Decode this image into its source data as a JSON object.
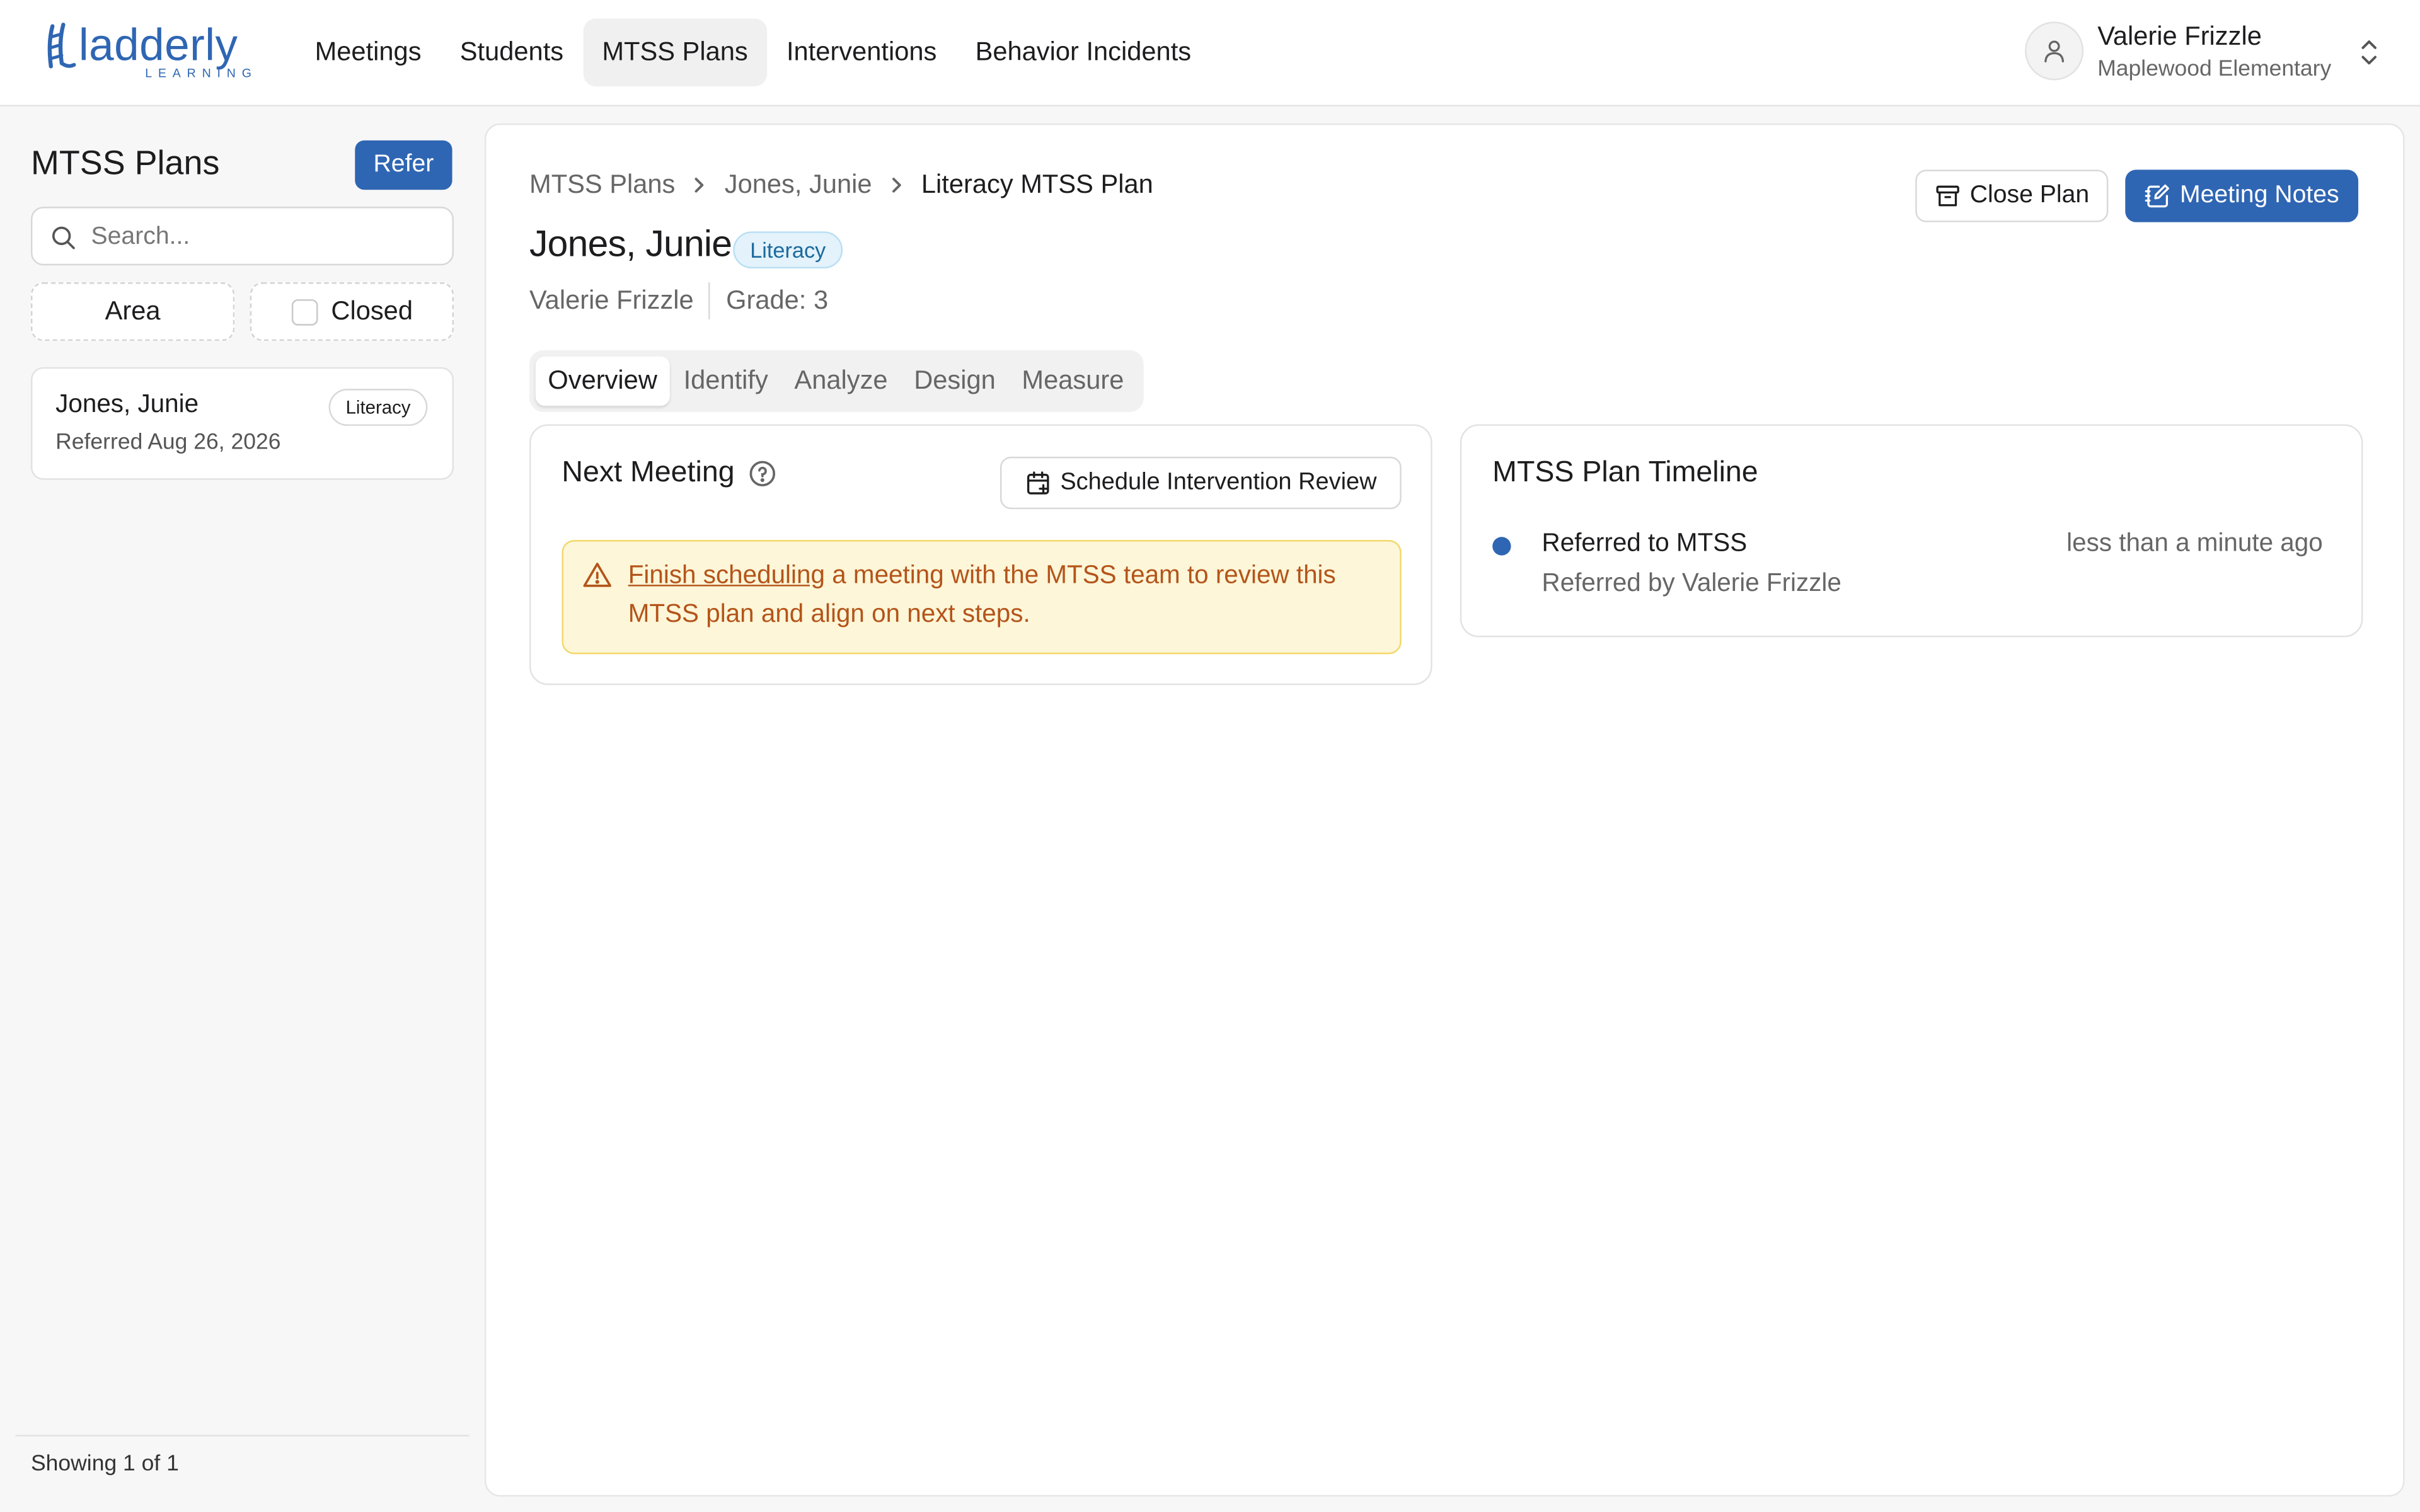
{
  "brand": {
    "name": "ladderly",
    "sub": "LEARNING",
    "color": "#2f66b3"
  },
  "nav": {
    "items": [
      {
        "label": "Meetings",
        "active": false
      },
      {
        "label": "Students",
        "active": false
      },
      {
        "label": "MTSS Plans",
        "active": true
      },
      {
        "label": "Interventions",
        "active": false
      },
      {
        "label": "Behavior Incidents",
        "active": false
      }
    ]
  },
  "user": {
    "name": "Valerie Frizzle",
    "school": "Maplewood Elementary",
    "avatar_icon": "user-icon",
    "switch_icon": "chevrons-up-down-icon"
  },
  "sidebar": {
    "title": "MTSS Plans",
    "refer_label": "Refer",
    "search_placeholder": "Search...",
    "search_value": "",
    "filters": {
      "area_label": "Area",
      "closed_label": "Closed",
      "closed_checked": false
    },
    "plans": [
      {
        "name": "Jones, Junie",
        "badge": "Literacy",
        "referred": "Referred Aug 26, 2026"
      }
    ],
    "footer": "Showing 1 of 1"
  },
  "main": {
    "breadcrumb": [
      "MTSS Plans",
      "Jones, Junie",
      "Literacy MTSS Plan"
    ],
    "student_name": "Jones, Junie",
    "area_badge": "Literacy",
    "owner": "Valerie Frizzle",
    "grade": "Grade: 3",
    "close_label": "Close Plan",
    "notes_label": "Meeting Notes",
    "tabs": [
      {
        "label": "Overview",
        "active": true
      },
      {
        "label": "Identify",
        "active": false
      },
      {
        "label": "Analyze",
        "active": false
      },
      {
        "label": "Design",
        "active": false
      },
      {
        "label": "Measure",
        "active": false
      }
    ],
    "next_meeting": {
      "title": "Next Meeting",
      "schedule_label": "Schedule Intervention Review",
      "warning_link": "Finish scheduling",
      "warning_text": " a meeting with the MTSS team to review this MTSS plan and align on next steps."
    },
    "timeline": {
      "title": "MTSS Plan Timeline",
      "events": [
        {
          "event": "Referred to MTSS",
          "by": "Referred by Valerie Frizzle",
          "time": "less than a minute ago"
        }
      ]
    }
  },
  "colors": {
    "accent": "#2f66b3",
    "badge_bg": "#e3f2fb",
    "badge_text": "#1b6a9e",
    "warning_bg": "#fdf6d8",
    "warning_border": "#f2d86b",
    "warning_text": "#b4541a"
  }
}
